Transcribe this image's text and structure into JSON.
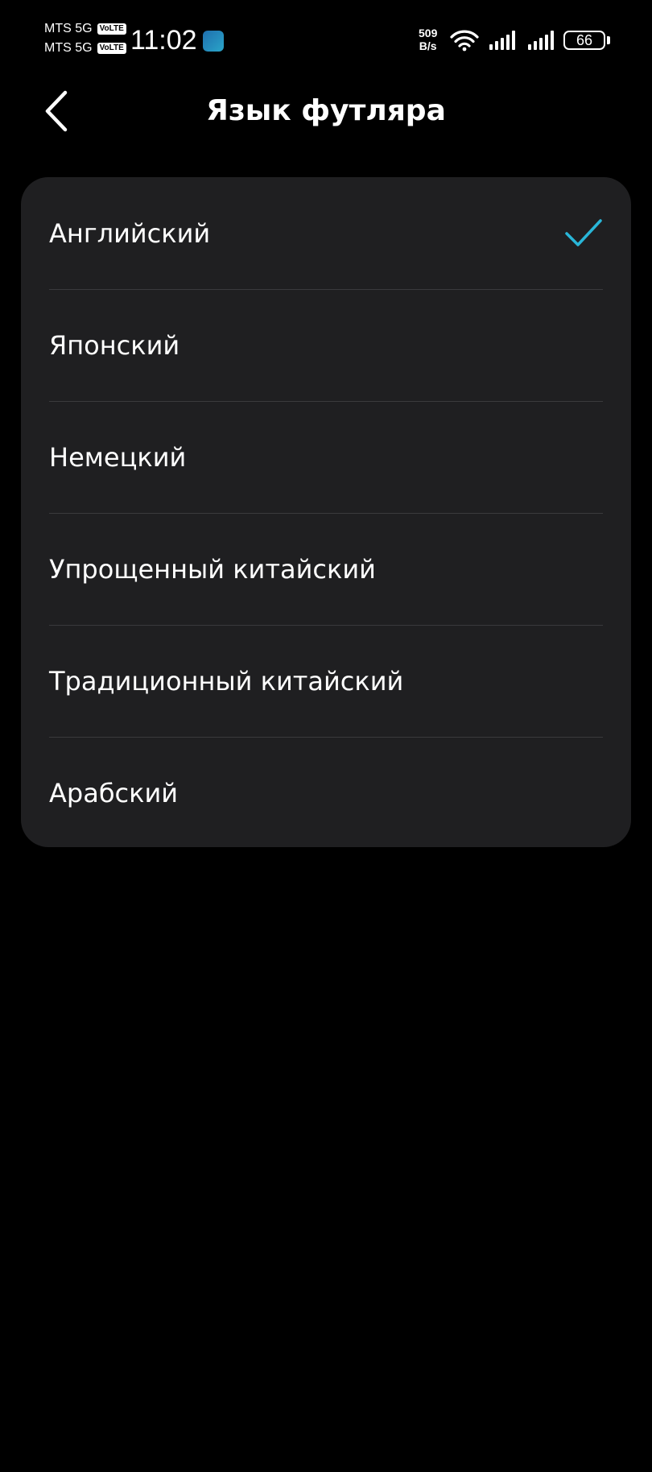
{
  "status_bar": {
    "carrier_1": "MTS 5G",
    "carrier_2": "MTS 5G",
    "volte_label": "VoLTE",
    "time": "11:02",
    "net_speed_value": "509",
    "net_speed_unit": "B/s",
    "battery": "66",
    "icons": [
      "app-badge-icon",
      "wifi-icon",
      "signal-icon",
      "signal-icon",
      "battery-icon"
    ]
  },
  "header": {
    "title": "Язык футляра",
    "back_icon": "chevron-left-icon"
  },
  "languages": {
    "items": [
      {
        "label": "Английский",
        "selected": true
      },
      {
        "label": "Японский",
        "selected": false
      },
      {
        "label": "Немецкий",
        "selected": false
      },
      {
        "label": "Упрощенный китайский",
        "selected": false
      },
      {
        "label": "Традиционный китайский",
        "selected": false
      },
      {
        "label": "Арабский",
        "selected": false
      }
    ],
    "check_icon": "checkmark-icon"
  },
  "colors": {
    "background": "#000000",
    "card": "#1f1f21",
    "divider": "#3a3a3d",
    "accent": "#29b6d8",
    "text": "#ffffff"
  }
}
